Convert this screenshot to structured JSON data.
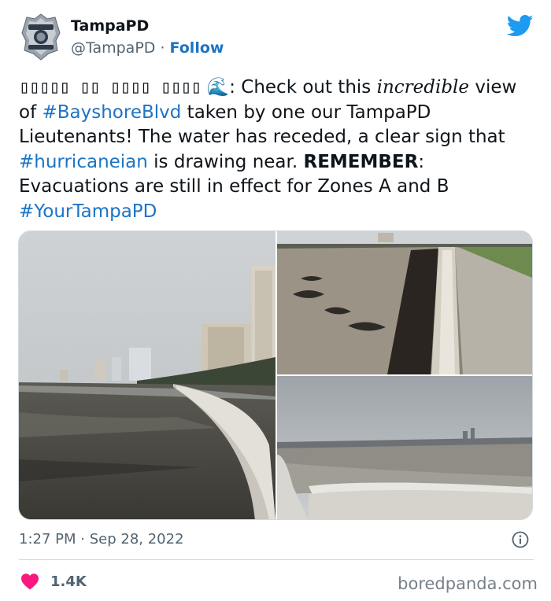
{
  "header": {
    "name": "TampaPD",
    "handle": "@TampaPD",
    "separator": "·",
    "follow_label": "Follow"
  },
  "tweet": {
    "prefix_boxes": "▯▯▯▯▯ ▯▯ ▯▯▯▯ ▯▯▯▯",
    "emoji": "🌊",
    "p1": ": Check out this ",
    "p2_italic": "incredible",
    "p3": " view of ",
    "tag1": "#BayshoreBlvd",
    "p4": " taken by one our TampaPD Lieutenants! The water has receded, a clear sign that ",
    "tag2": "#hurricaneian",
    "p5": " is drawing near. ",
    "p6_bold": "REMEMBER",
    "p7": ": Evacuations are still in effect for Zones A and B ",
    "tag3": "#YourTampaPD"
  },
  "meta": {
    "time": "1:27 PM",
    "separator": "·",
    "date": "Sep 28, 2022"
  },
  "engagement": {
    "likes": "1.4K"
  },
  "watermark": "boredpanda.com",
  "colors": {
    "link": "#1d74c4",
    "heart": "#f91880",
    "twitter_blue": "#1d9bf0"
  }
}
